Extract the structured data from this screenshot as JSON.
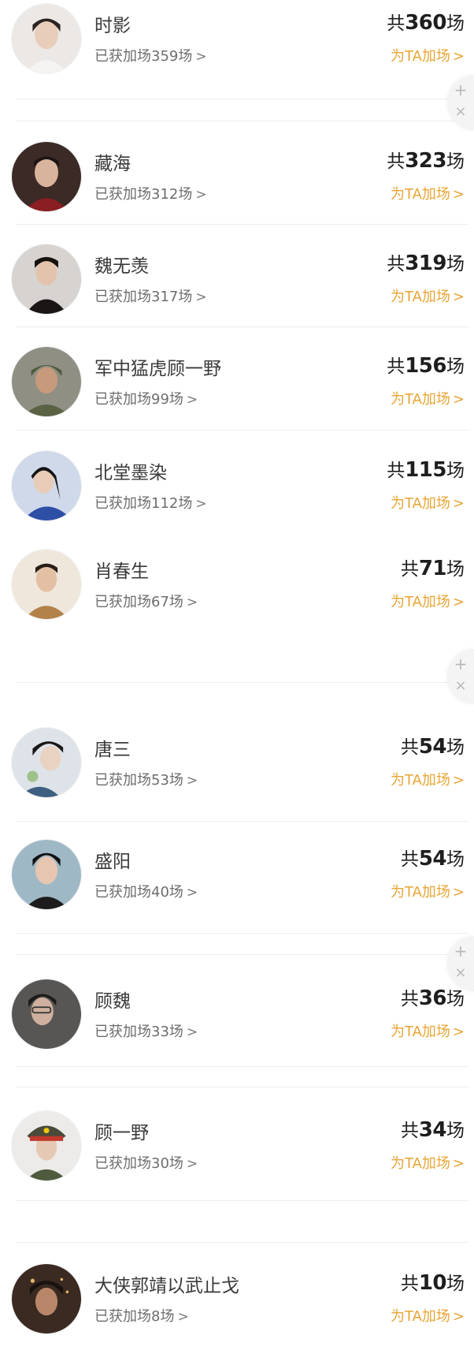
{
  "list": {
    "total_prefix": "共",
    "total_suffix": "场",
    "earned_prefix": "已获加场",
    "earned_suffix": "场",
    "boost_label": "为TA加场",
    "chevron": ">",
    "items": [
      {
        "name": "时影",
        "earned": "359",
        "total": "360"
      },
      {
        "name": "藏海",
        "earned": "312",
        "total": "323"
      },
      {
        "name": "魏无羡",
        "earned": "317",
        "total": "319"
      },
      {
        "name": "军中猛虎顾一野",
        "earned": "99",
        "total": "156"
      },
      {
        "name": "北堂墨染",
        "earned": "112",
        "total": "115"
      },
      {
        "name": "肖春生",
        "earned": "67",
        "total": "71"
      },
      {
        "name": "唐三",
        "earned": "53",
        "total": "54"
      },
      {
        "name": "盛阳",
        "earned": "40",
        "total": "54"
      },
      {
        "name": "顾魏",
        "earned": "33",
        "total": "36"
      },
      {
        "name": "顾一野",
        "earned": "30",
        "total": "34"
      },
      {
        "name": "大侠郭靖以武止戈",
        "earned": "8",
        "total": "10"
      }
    ]
  },
  "floating_widget": {
    "plus": "+",
    "close": "×"
  }
}
